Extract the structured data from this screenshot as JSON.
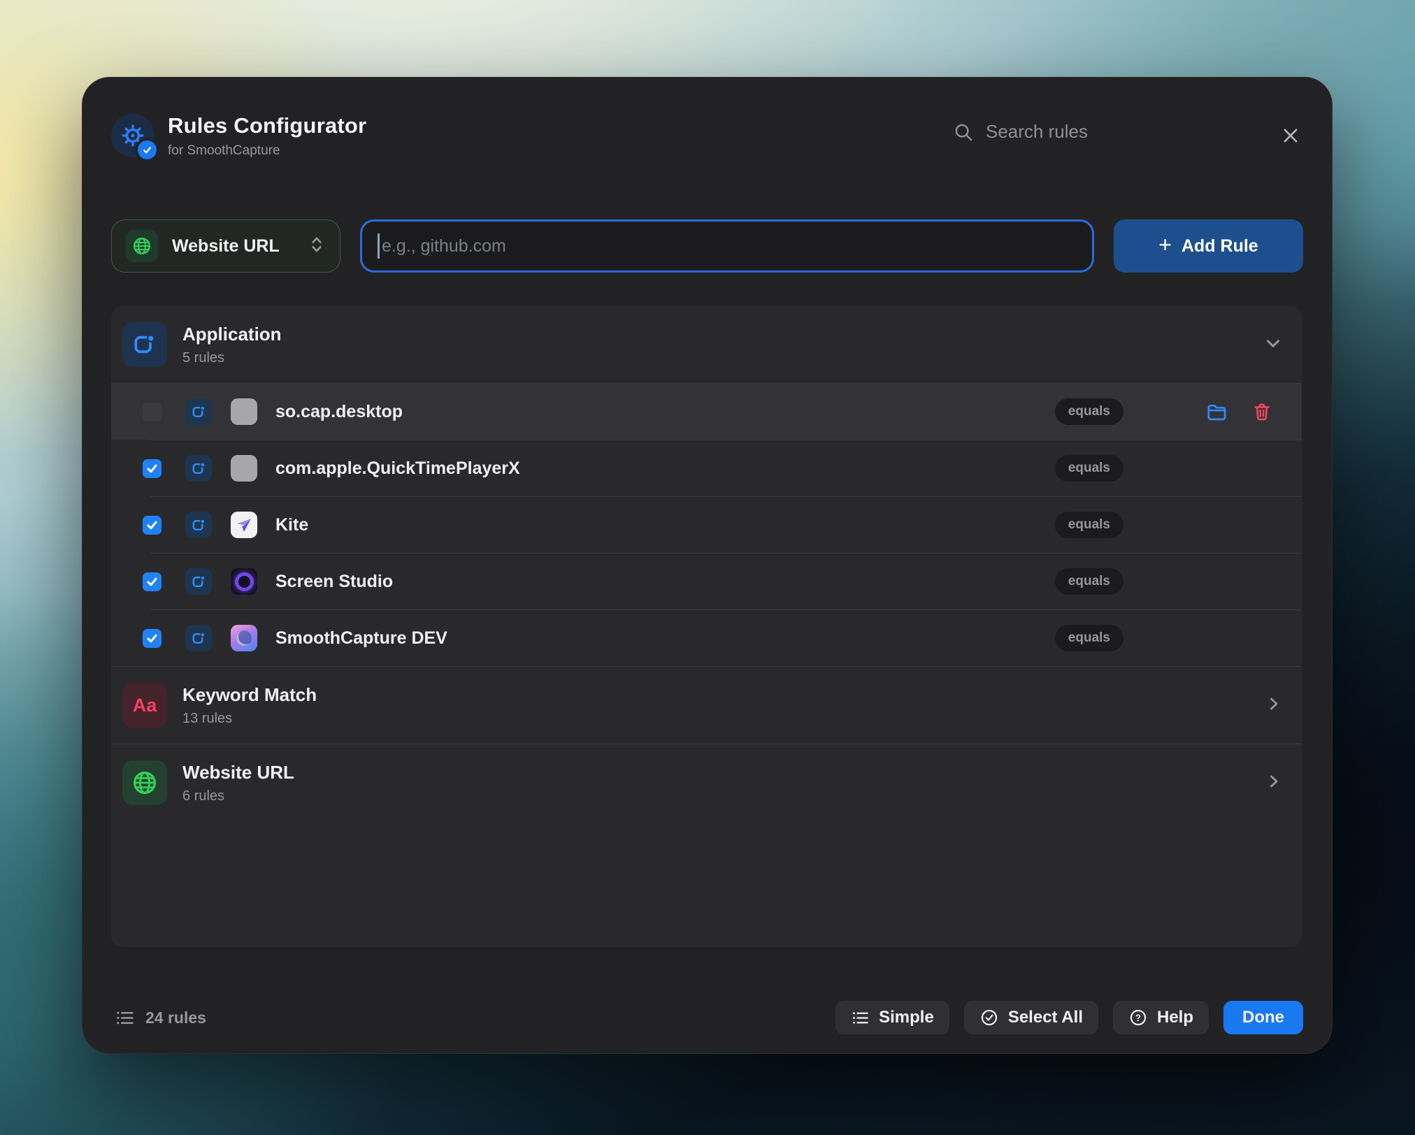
{
  "window": {
    "title": "Rules Configurator",
    "subtitle": "for SmoothCapture",
    "search_placeholder": "Search rules"
  },
  "toolbar": {
    "selector_label": "Website URL",
    "input_placeholder": "e.g., github.com",
    "add_rule_label": "Add Rule",
    "plus": "+"
  },
  "groups": [
    {
      "name": "Application",
      "count": "5 rules",
      "expanded": true,
      "rules": [
        {
          "label": "so.cap.desktop",
          "operator": "equals",
          "checked": false,
          "hovered": true
        },
        {
          "label": "com.apple.QuickTimePlayerX",
          "operator": "equals",
          "checked": true
        },
        {
          "label": "Kite",
          "operator": "equals",
          "checked": true
        },
        {
          "label": "Screen Studio",
          "operator": "equals",
          "checked": true
        },
        {
          "label": "SmoothCapture DEV",
          "operator": "equals",
          "checked": true
        }
      ]
    },
    {
      "name": "Keyword Match",
      "count": "13 rules",
      "icon_text": "Aa",
      "expanded": false
    },
    {
      "name": "Website URL",
      "count": "6 rules",
      "expanded": false
    }
  ],
  "footer": {
    "count_label": "24 rules",
    "buttons": [
      {
        "label": "Simple"
      },
      {
        "label": "Select All"
      },
      {
        "label": "Help"
      },
      {
        "label": "Done"
      }
    ]
  },
  "colors": {
    "accent_blue": "#1879f2",
    "add_rule_blue": "#1d4f8e",
    "checkbox_blue": "#2082f7",
    "folder_blue": "#2e8bff",
    "green": "#2fd159",
    "red": "#f4455e",
    "window_bg": "#222224",
    "list_bg": "#29292c"
  }
}
